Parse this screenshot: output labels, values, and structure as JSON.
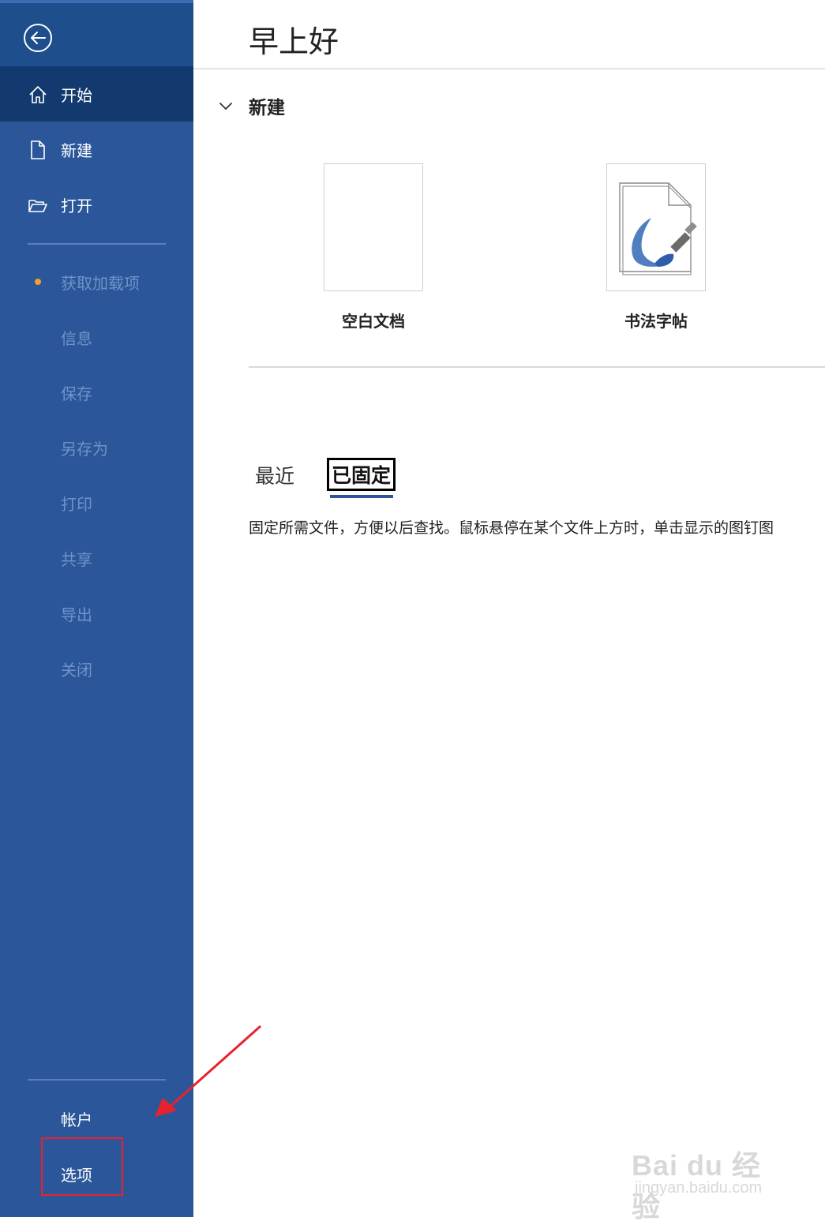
{
  "sidebar": {
    "items": [
      {
        "label": "开始",
        "icon": "home-icon"
      },
      {
        "label": "新建",
        "icon": "new-document-icon"
      },
      {
        "label": "打开",
        "icon": "open-folder-icon"
      },
      {
        "label": "获取加载项"
      },
      {
        "label": "信息"
      },
      {
        "label": "保存"
      },
      {
        "label": "另存为"
      },
      {
        "label": "打印"
      },
      {
        "label": "共享"
      },
      {
        "label": "导出"
      },
      {
        "label": "关闭"
      }
    ],
    "footer": [
      {
        "label": "帐户"
      },
      {
        "label": "选项"
      }
    ],
    "colors": {
      "background": "#2b579a",
      "active": "#123a6f",
      "disabled_text": "#6f93c9",
      "badge": "#f0a030"
    }
  },
  "main": {
    "greeting": "早上好",
    "new_section": {
      "label": "新建",
      "templates": [
        {
          "name": "空白文档"
        },
        {
          "name": "书法字帖"
        }
      ]
    },
    "tabs": [
      {
        "label": "最近"
      },
      {
        "label": "已固定"
      }
    ],
    "hint": "固定所需文件，方便以后查找。鼠标悬停在某个文件上方时，单击显示的图钉图"
  },
  "annotation": {
    "highlight_color": "#e8222d"
  },
  "watermark": {
    "line1": "Bai du 经验",
    "line2": "jingyan.baidu.com"
  }
}
